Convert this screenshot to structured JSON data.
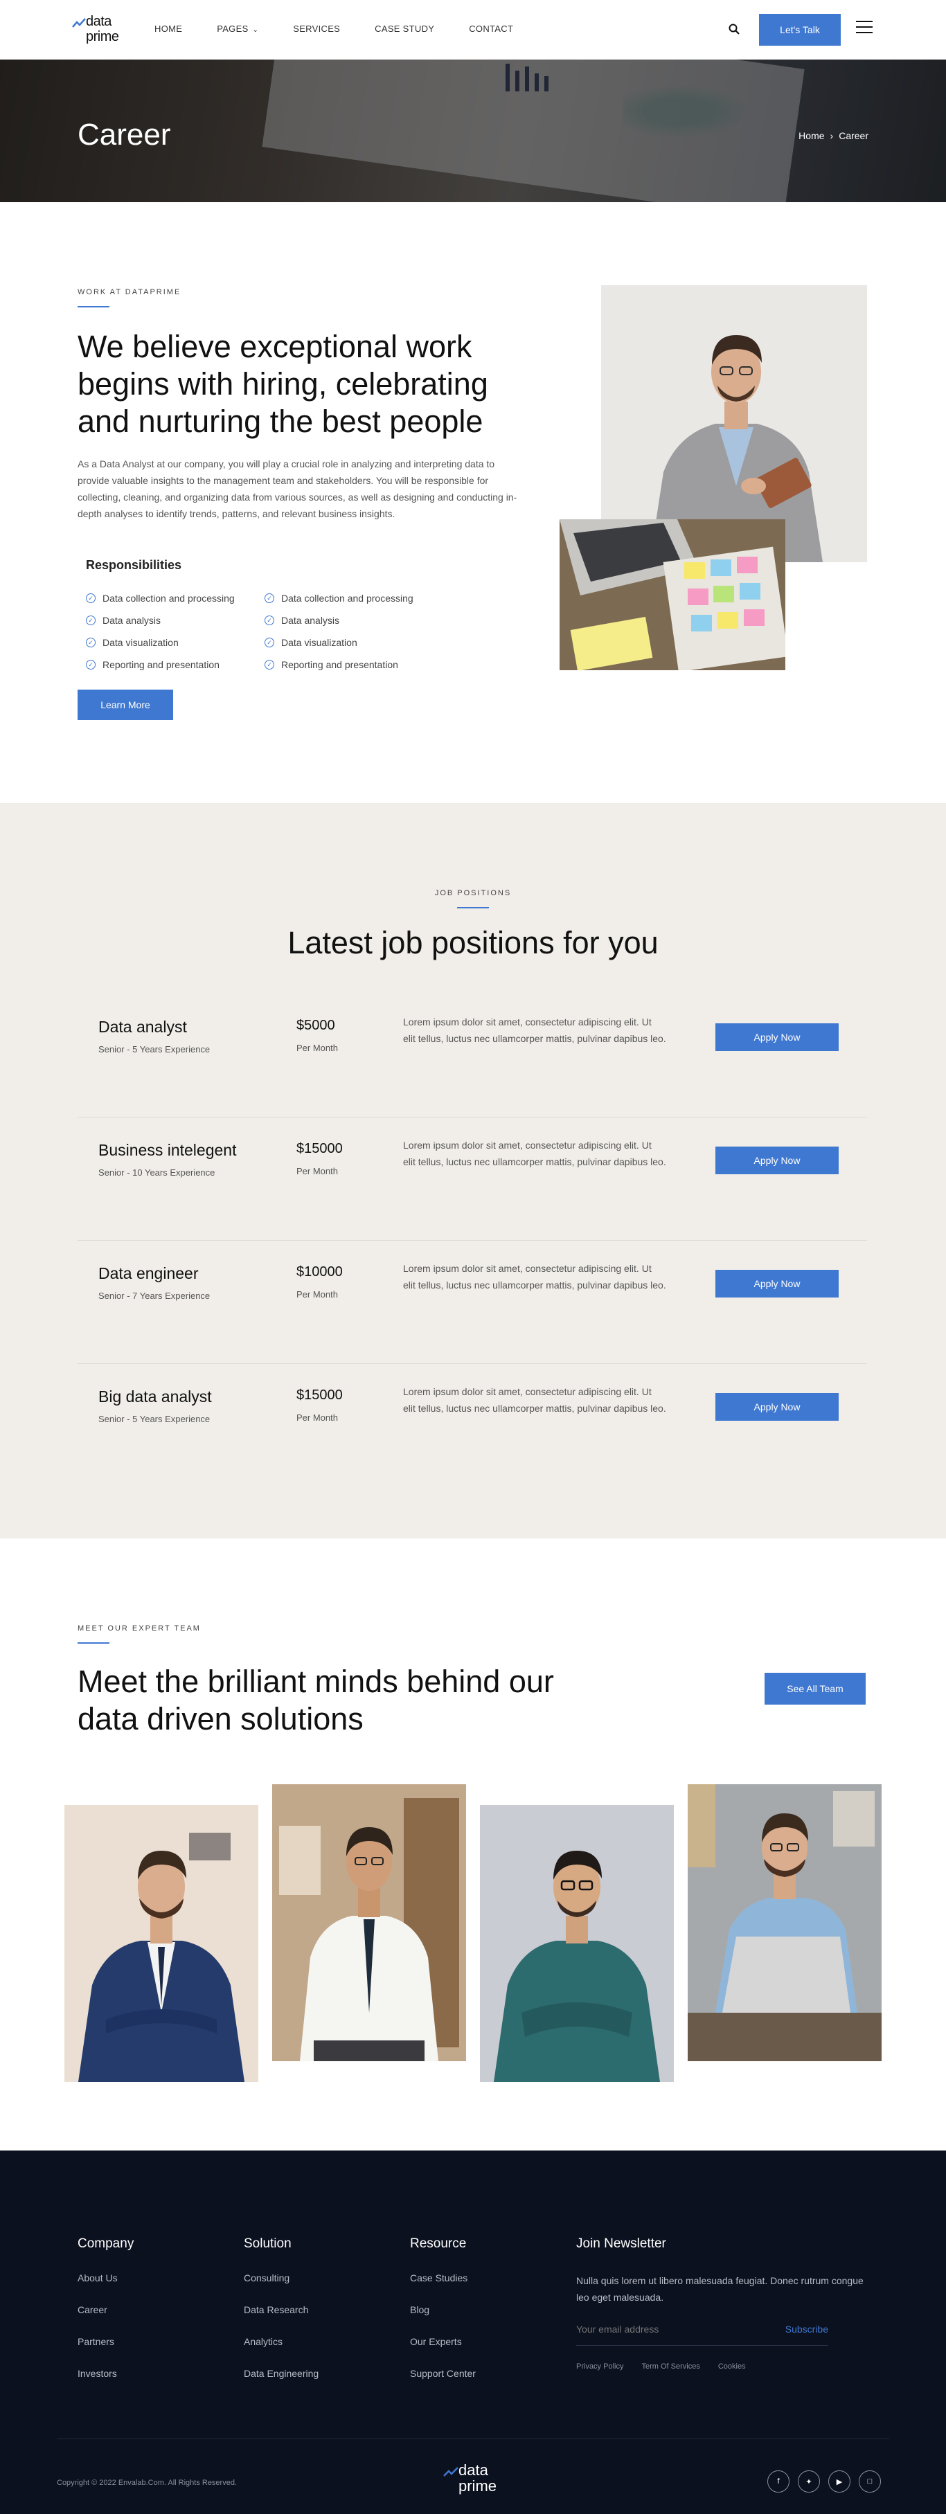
{
  "brand": {
    "line1": "data",
    "line2": "prime"
  },
  "nav": {
    "items": [
      "HOME",
      "PAGES",
      "SERVICES",
      "CASE STUDY",
      "CONTACT"
    ],
    "cta": "Let's Talk"
  },
  "banner": {
    "title": "Career",
    "breadcrumb": {
      "home": "Home",
      "current": "Career"
    }
  },
  "about": {
    "kicker": "WORK AT DATAPRIME",
    "title": "We believe exceptional work begins with hiring, celebrating and nurturing the best people",
    "text": "As a Data Analyst at our company, you will play a crucial role in analyzing and interpreting data to provide valuable insights to the management team and stakeholders. You will be responsible for collecting, cleaning, and organizing data from various sources, as well as designing and conducting in-depth analyses to identify trends, patterns, and relevant business insights.",
    "responsibilities_title": "Responsibilities",
    "responsibilities_left": [
      "Data collection and processing",
      "Data analysis",
      "Data visualization",
      "Reporting and presentation"
    ],
    "responsibilities_right": [
      "Data collection and processing",
      "Data analysis",
      "Data visualization",
      "Reporting and presentation"
    ],
    "button": "Learn More"
  },
  "jobs": {
    "kicker": "JOB POSITIONS",
    "title": "Latest job positions for you",
    "list": [
      {
        "title": "Data analyst",
        "experience": "Senior - 5 Years Experience",
        "salary": "$5000",
        "period": "Per Month",
        "desc": "Lorem ipsum dolor sit amet, consectetur adipiscing elit. Ut elit tellus, luctus nec ullamcorper mattis, pulvinar dapibus leo.",
        "button": "Apply Now"
      },
      {
        "title": "Business intelegent",
        "experience": "Senior - 10 Years Experience",
        "salary": "$15000",
        "period": "Per Month",
        "desc": "Lorem ipsum dolor sit amet, consectetur adipiscing elit. Ut elit tellus, luctus nec ullamcorper mattis, pulvinar dapibus leo.",
        "button": "Apply Now"
      },
      {
        "title": "Data engineer",
        "experience": "Senior - 7 Years Experience",
        "salary": "$10000",
        "period": "Per Month",
        "desc": "Lorem ipsum dolor sit amet, consectetur adipiscing elit. Ut elit tellus, luctus nec ullamcorper mattis, pulvinar dapibus leo.",
        "button": "Apply Now"
      },
      {
        "title": "Big data analyst",
        "experience": "Senior - 5 Years Experience",
        "salary": "$15000",
        "period": "Per Month",
        "desc": "Lorem ipsum dolor sit amet, consectetur adipiscing elit. Ut elit tellus, luctus nec ullamcorper mattis, pulvinar dapibus leo.",
        "button": "Apply Now"
      }
    ]
  },
  "team": {
    "kicker": "MEET OUR EXPERT TEAM",
    "title": "Meet the brilliant minds behind our data driven solutions",
    "button": "See All Team"
  },
  "footer": {
    "company": {
      "title": "Company",
      "links": [
        "About Us",
        "Career",
        "Partners",
        "Investors"
      ]
    },
    "solution": {
      "title": "Solution",
      "links": [
        "Consulting",
        "Data Research",
        "Analytics",
        "Data Engineering"
      ]
    },
    "resource": {
      "title": "Resource",
      "links": [
        "Case Studies",
        "Blog",
        "Our Experts",
        "Support Center"
      ]
    },
    "newsletter": {
      "title": "Join Newsletter",
      "text": "Nulla quis lorem ut libero malesuada feugiat. Donec rutrum congue leo eget malesuada.",
      "placeholder": "Your email address",
      "button": "Subscribe",
      "policies": [
        "Privacy Policy",
        "Term Of Services",
        "Cookies"
      ]
    },
    "copyright": "Copyright © 2022 Envalab.Com. All Rights Reserved.",
    "social": [
      "facebook-icon",
      "twitter-icon",
      "youtube-icon",
      "instagram-icon"
    ]
  },
  "colors": {
    "accent": "#3f78d1",
    "footer_bg": "#0c111f",
    "jobs_bg": "#f1eee9"
  }
}
